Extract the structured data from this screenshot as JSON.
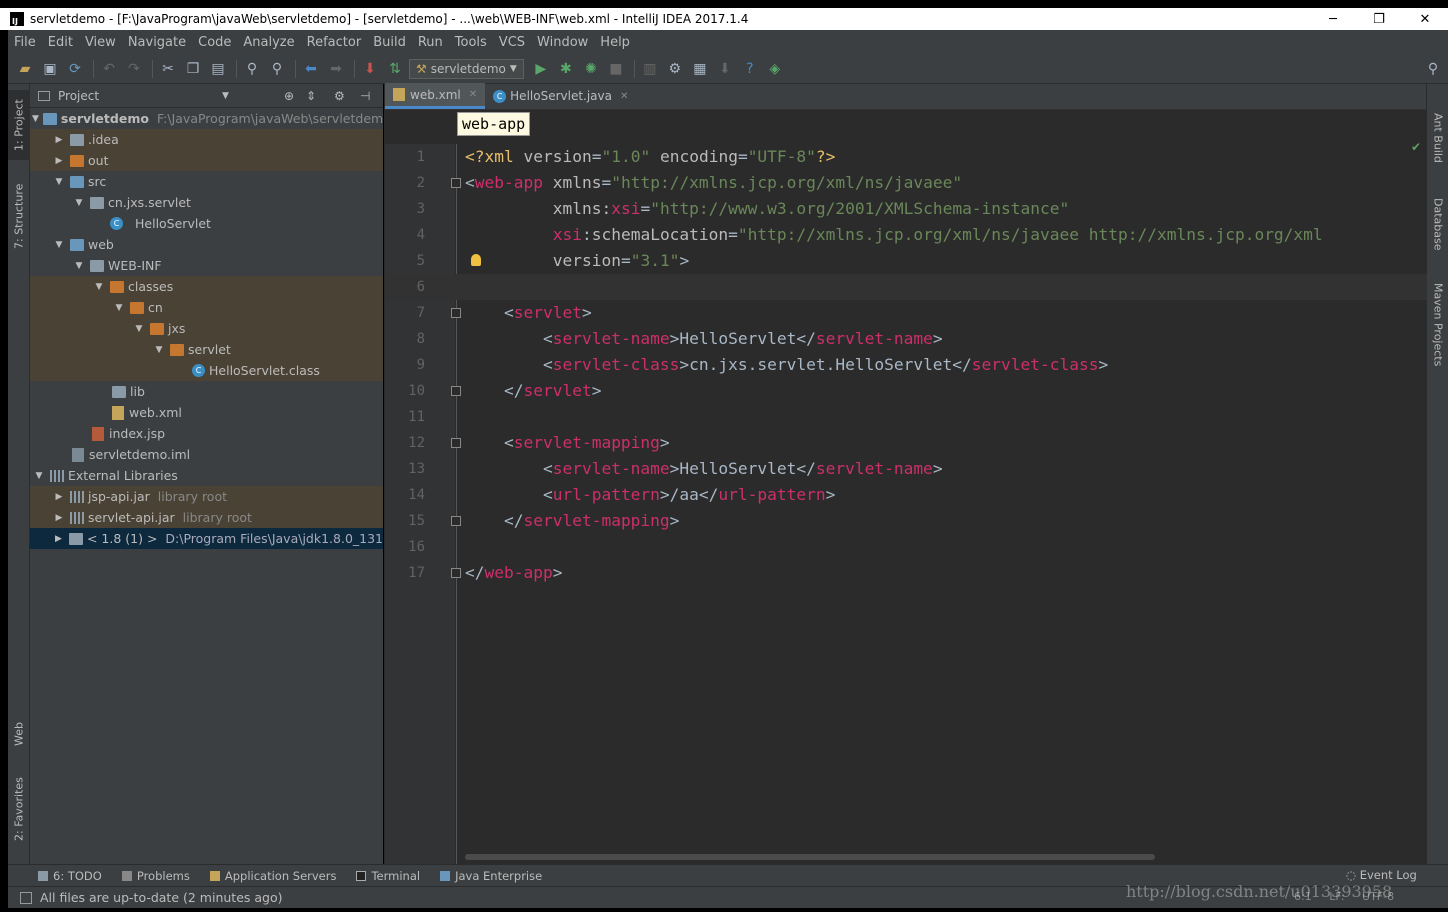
{
  "window": {
    "title": "servletdemo - [F:\\JavaProgram\\javaWeb\\servletdemo] - [servletdemo] - ...\\web\\WEB-INF\\web.xml - IntelliJ IDEA 2017.1.4",
    "minimize": "─",
    "maximize": "❐",
    "close": "✕"
  },
  "menu": [
    "File",
    "Edit",
    "View",
    "Navigate",
    "Code",
    "Analyze",
    "Refactor",
    "Build",
    "Run",
    "Tools",
    "VCS",
    "Window",
    "Help"
  ],
  "toolbar": {
    "run_config": "servletdemo"
  },
  "left_tabs": {
    "project": "1: Project",
    "structure": "7: Structure",
    "web": "Web",
    "favorites": "2: Favorites"
  },
  "right_tabs": {
    "ant": "Ant Build",
    "database": "Database",
    "maven": "Maven Projects"
  },
  "project_panel": {
    "title": "Project",
    "tree": [
      {
        "label": "servletdemo",
        "extra": "F:\\JavaProgram\\javaWeb\\servletdemo",
        "bold": true
      },
      {
        "label": ".idea"
      },
      {
        "label": "out"
      },
      {
        "label": "src"
      },
      {
        "label": "cn.jxs.servlet"
      },
      {
        "label": "HelloServlet"
      },
      {
        "label": "web"
      },
      {
        "label": "WEB-INF"
      },
      {
        "label": "classes"
      },
      {
        "label": "cn"
      },
      {
        "label": "jxs"
      },
      {
        "label": "servlet"
      },
      {
        "label": "HelloServlet.class"
      },
      {
        "label": "lib"
      },
      {
        "label": "web.xml"
      },
      {
        "label": "index.jsp"
      },
      {
        "label": "servletdemo.iml"
      },
      {
        "label": "External Libraries"
      },
      {
        "label": "jsp-api.jar",
        "extra": "library root"
      },
      {
        "label": "servlet-api.jar",
        "extra": "library root"
      },
      {
        "label": "< 1.8 (1) >",
        "extra": "D:\\Program Files\\Java\\jdk1.8.0_131"
      }
    ]
  },
  "editor": {
    "tabs": [
      "web.xml",
      "HelloServlet.java"
    ],
    "breadcrumb": "web-app",
    "line_numbers": [
      "1",
      "2",
      "3",
      "4",
      "5",
      "6",
      "7",
      "8",
      "9",
      "10",
      "11",
      "12",
      "13",
      "14",
      "15",
      "16",
      "17"
    ]
  },
  "bottom_tools": [
    "6: TODO",
    "Problems",
    "Application Servers",
    "Terminal",
    "Java Enterprise"
  ],
  "event_log": "Event Log",
  "status": {
    "message": "All files are up-to-date (2 minutes ago)",
    "position": "6:1",
    "line_sep": "LF:",
    "encoding": "UTF-8"
  },
  "watermark": "http://blog.csdn.net/u013393958"
}
